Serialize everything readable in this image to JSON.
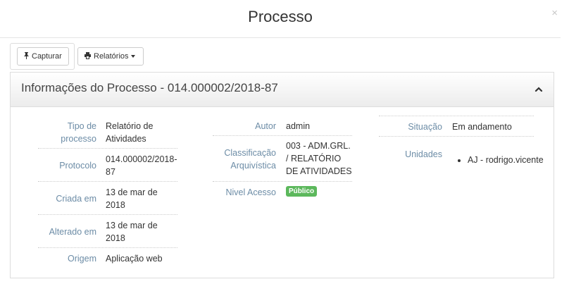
{
  "modal": {
    "title": "Processo",
    "close": "×"
  },
  "toolbar": {
    "capturar_label": "Capturar",
    "capturar_icon": "pin-icon",
    "relatorios_label": "Relatórios",
    "relatorios_icon": "printer-icon"
  },
  "panel": {
    "title": "Informações do Processo - 014.000002/2018-87"
  },
  "fields": {
    "tipo_label": "Tipo de processo",
    "tipo_value": "Relatório de Atividades",
    "protocolo_label": "Protocolo",
    "protocolo_value": "014.000002/2018-87",
    "criada_label": "Criada em",
    "criada_value": "13 de mar de 2018",
    "alterado_label": "Alterado em",
    "alterado_value": "13 de mar de 2018",
    "origem_label": "Origem",
    "origem_value": "Aplicação web",
    "autor_label": "Autor",
    "autor_value": "admin",
    "classificacao_label": "Classificação Arquivística",
    "classificacao_value": "003 - ADM.GRL. / RELATÓRIO DE ATIVIDADES",
    "nivel_label": "Nivel Acesso",
    "nivel_value": "Público",
    "situacao_label": "Situação",
    "situacao_value": "Em andamento",
    "unidades_label": "Unidades",
    "unidades_items": [
      "AJ - rodrigo.vicente"
    ]
  },
  "colors": {
    "label": "#6c8ca6",
    "badge": "#5cb85c"
  }
}
